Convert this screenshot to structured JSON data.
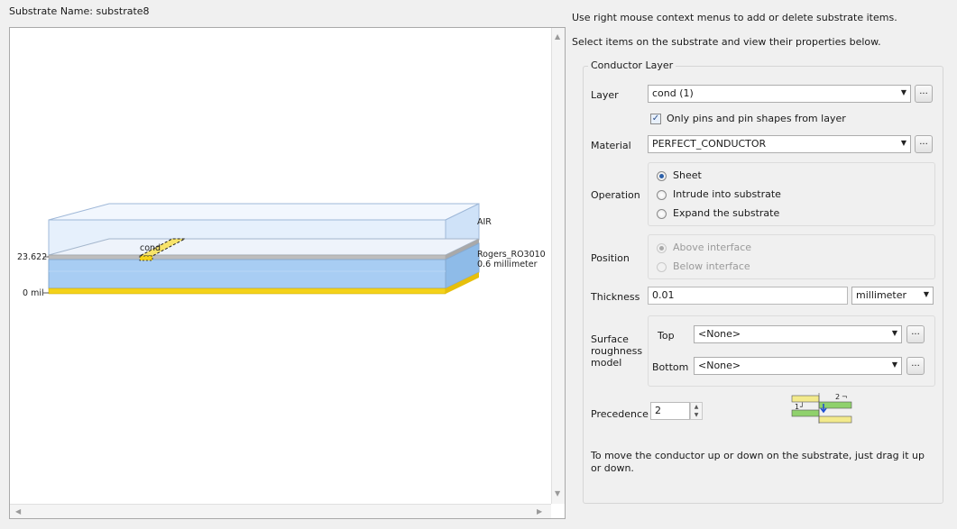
{
  "substrate": {
    "name_label": "Substrate Name: substrate8",
    "layers": {
      "air": "AIR",
      "dielectric_name": "Rogers_RO3010",
      "dielectric_thickness": "0.6 millimeter",
      "conductor": "cond"
    },
    "axis": {
      "top": "23.622",
      "bottom": "0 mil"
    }
  },
  "info": {
    "line1": "Use right mouse context menus to add or delete substrate items.",
    "line2": "Select items on the substrate and view their properties below."
  },
  "conductor_layer": {
    "group_title": "Conductor Layer",
    "layer": {
      "label": "Layer",
      "value": "cond (1)",
      "more": "..."
    },
    "only_pins": {
      "label": "Only pins and pin shapes from layer",
      "checked": true
    },
    "material": {
      "label": "Material",
      "value": "PERFECT_CONDUCTOR",
      "more": "..."
    },
    "operation": {
      "label": "Operation",
      "options": [
        "Sheet",
        "Intrude into substrate",
        "Expand the substrate"
      ],
      "selected": "Sheet"
    },
    "position": {
      "label": "Position",
      "options": [
        "Above interface",
        "Below interface"
      ],
      "selected": "Above interface",
      "enabled": false
    },
    "thickness": {
      "label": "Thickness",
      "value": "0.01",
      "unit": "millimeter"
    },
    "surface_roughness": {
      "label_lines": [
        "Surface",
        "roughness",
        "model"
      ],
      "top": {
        "label": "Top",
        "value": "<None>",
        "more": "..."
      },
      "bottom": {
        "label": "Bottom",
        "value": "<None>",
        "more": "..."
      }
    },
    "precedence": {
      "label": "Precedence",
      "value": "2",
      "diagram_labels": {
        "one": "1",
        "two": "2"
      }
    },
    "hint": "To move the conductor up or down on the substrate, just drag it up or down."
  },
  "colors": {
    "air_fill": "#dbe9fb",
    "dielectric_fill": "#a8cdf3",
    "conductor_fill": "#f4d21a",
    "interface_grey": "#bdbdbd"
  }
}
